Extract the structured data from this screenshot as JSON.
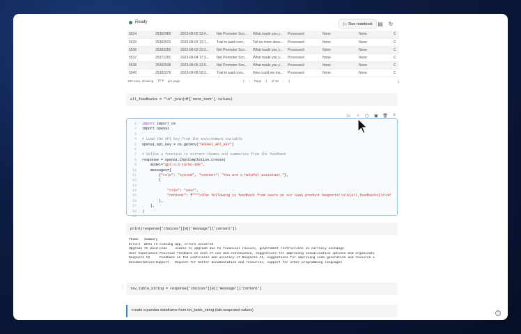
{
  "topbar": {
    "status": "Ready",
    "run_label": "Run notebook"
  },
  "table": {
    "rows": [
      [
        "5534",
        "25382989",
        "2023-08-02 23:4...",
        "Net Promoter Sco...",
        "What made you y...",
        "Processed",
        "None",
        "None",
        "C"
      ],
      [
        "5535",
        "25382922",
        "2023-08-03 12:1...",
        "Trial to paid conv...",
        "Tell us more abou...",
        "Processed",
        "None",
        "None",
        "C"
      ],
      [
        "5536",
        "25383255",
        "2023-08-03 22:3...",
        "Net Promoter Sco...",
        "What made you y...",
        "Processed",
        "None",
        "None",
        "C"
      ],
      [
        "5537",
        "25371281",
        "2023-08-04 17:3...",
        "Net Promoter Sco...",
        "What made you y...",
        "Processed",
        "None",
        "None",
        "C"
      ],
      [
        "5538",
        "25382538",
        "2023-08-05 23:0...",
        "Net Promoter Sco...",
        "What made you y...",
        "Processed",
        "None",
        "None",
        "C"
      ],
      [
        "5540",
        "25382376",
        "2023-08-08 03:3...",
        "Trial to paid conv...",
        "How could we ma...",
        "Processed",
        "None",
        "None",
        "C"
      ]
    ],
    "pager_left": "180 rows, showing",
    "pager_per_page": "per page",
    "pager_nav": "Page",
    "pager_of": "of 18"
  },
  "cell1": {
    "code": "all_feedbacks = \"\\n\".join(df['note_text'].values)"
  },
  "cell2": {
    "line_numbers": [
      "1",
      "2",
      "3",
      "4",
      "5",
      "6",
      "7",
      "8",
      "9",
      "10",
      "11",
      "12",
      "13",
      "14",
      "15",
      "16",
      "17",
      "18",
      "19"
    ],
    "l1": "import os",
    "l2": "import openai",
    "l4": "# Load the API key from the environment variable",
    "l5a": "openai.api_key = os.getenv(",
    "l5b": "\"OPENAI_API_KEY\"",
    "l5c": ")",
    "l7": "# Define a function to extract themes and summaries from the feedback",
    "l8": "response = openai.ChatCompletion.create(",
    "l9a": "    model=",
    "l9b": "\"gpt-3.5-turbo-16k\"",
    "l9c": ",",
    "l10": "    messages=[",
    "l11a": "        {",
    "l11b": "\"role\"",
    "l11c": ": ",
    "l11d": "\"system\"",
    "l11e": ", ",
    "l11f": "\"content\"",
    "l11g": ": ",
    "l11h": "\"You are a helpful assistant.\"",
    "l11i": "},",
    "l12": "        {",
    "l13a": "            ",
    "l13b": "\"role\"",
    "l13c": ": ",
    "l13d": "\"user\"",
    "l13e": ",",
    "l14a": "            ",
    "l14b": "\"content\"",
    "l14c": ": f",
    "l14d": "\"\"\"\\nThe following is feedback from users on our SaaS product Deepnote:\\n\\n{all_feedbacks}\\n\\nP",
    "l15": "        },",
    "l16": "    ],",
    "l17": ")"
  },
  "cell3": {
    "code": "print(response['choices'][0]['message']['content'])"
  },
  "output": {
    "lines": [
      "Theme   Summary",
      "Errors  when re-running app, errors occurred",
      "Upgrade to paid plan    unable to upgrade due to financial reasons, government restrictions on currency exchange",
      "User Experience Positive feedback on ease of use and convenience, suggestions for improving visualization options and organizati",
      "Deepnote AI     Feedback on the usefulness and accuracy of Deepnote AI, suggestions for improving code generation and resource a",
      "Documentation/Support   Request for better documentation and resources, support for other programming languages"
    ]
  },
  "cell4": {
    "code": "tsv_table_string = response['choices'][0]['message']['content']"
  },
  "md_cell": {
    "text": "create a pandas dataframe from tsv_table_string (tab-seaprated values)"
  }
}
